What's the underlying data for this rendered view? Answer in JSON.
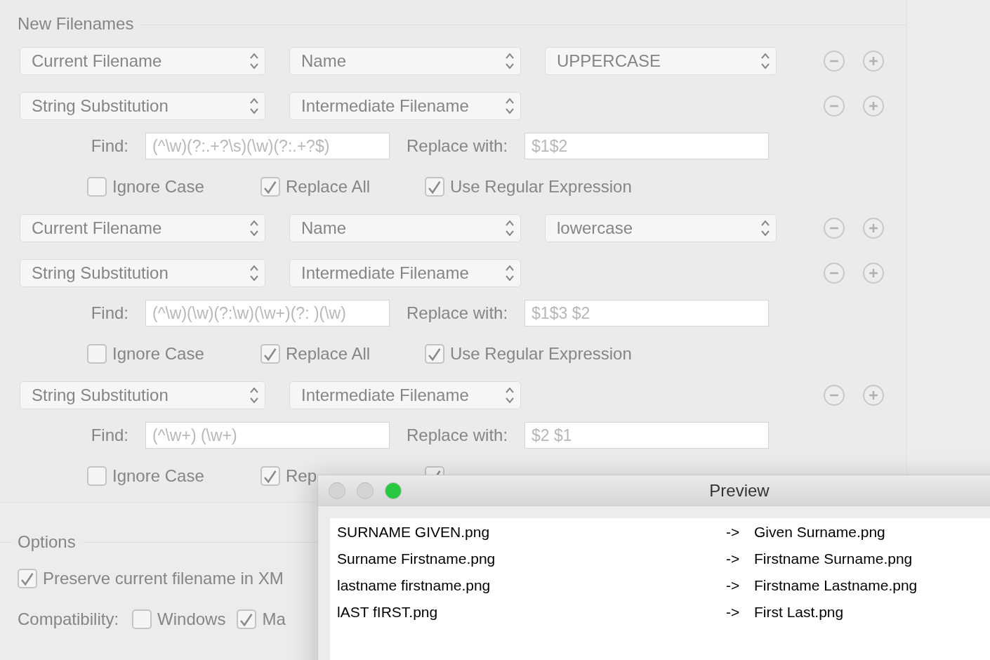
{
  "new_filenames": {
    "title": "New Filenames",
    "rules": [
      {
        "kind": "popups",
        "popups": [
          "Current Filename",
          "Name",
          "UPPERCASE"
        ]
      },
      {
        "kind": "substitution",
        "popups": [
          "String Substitution",
          "Intermediate Filename"
        ],
        "find_label": "Find:",
        "find": "(^\\w)(?:.+?\\s)(\\w)(?:.+?$)",
        "replace_label": "Replace with:",
        "replace": "$1$2",
        "options": [
          {
            "label": "Ignore Case",
            "checked": false
          },
          {
            "label": "Replace All",
            "checked": true
          },
          {
            "label": "Use Regular Expression",
            "checked": true
          }
        ]
      },
      {
        "kind": "popups",
        "popups": [
          "Current Filename",
          "Name",
          "lowercase"
        ]
      },
      {
        "kind": "substitution",
        "popups": [
          "String Substitution",
          "Intermediate Filename"
        ],
        "find_label": "Find:",
        "find": "(^\\w)(\\w)(?:\\w)(\\w+)(?: )(\\w)",
        "replace_label": "Replace with:",
        "replace": "$1$3 $2",
        "options": [
          {
            "label": "Ignore Case",
            "checked": false
          },
          {
            "label": "Replace All",
            "checked": true
          },
          {
            "label": "Use Regular Expression",
            "checked": true
          }
        ]
      },
      {
        "kind": "substitution",
        "popups": [
          "String Substitution",
          "Intermediate Filename"
        ],
        "find_label": "Find:",
        "find": "(^\\w+) (\\w+)",
        "replace_label": "Replace with:",
        "replace": "$2 $1",
        "options": [
          {
            "label": "Ignore Case",
            "checked": false
          },
          {
            "label": "Rep",
            "checked": true
          },
          {
            "checked": true
          }
        ]
      }
    ]
  },
  "options": {
    "title": "Options",
    "preserve": {
      "label": "Preserve current filename in XM",
      "checked": true
    },
    "compatibility": {
      "label": "Compatibility:",
      "options": [
        {
          "label": "Windows",
          "checked": false
        },
        {
          "label": "Ma",
          "checked": true
        }
      ]
    }
  },
  "preview": {
    "title": "Preview",
    "window_buttons": [
      {
        "kind": "close",
        "enabled": false
      },
      {
        "kind": "minimize",
        "enabled": false
      },
      {
        "kind": "zoom",
        "enabled": true
      }
    ],
    "rows": [
      {
        "source": "SURNAME GIVEN.png",
        "arrow": "->",
        "target": "Given Surname.png"
      },
      {
        "source": "Surname Firstname.png",
        "arrow": "->",
        "target": "Firstname Surname.png"
      },
      {
        "source": "lastname firstname.png",
        "arrow": "->",
        "target": "Firstname Lastname.png"
      },
      {
        "source": "lAST fIRST.png",
        "arrow": "->",
        "target": "First Last.png"
      }
    ]
  }
}
